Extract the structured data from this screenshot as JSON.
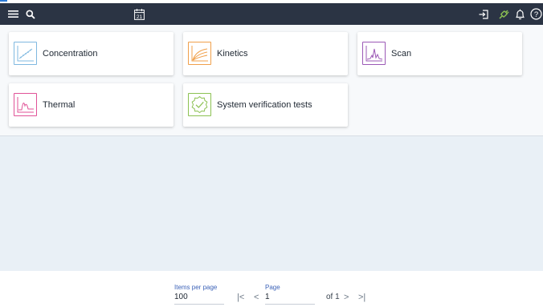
{
  "toolbar": {
    "menu_icon": "menu-icon",
    "search_icon": "search-icon",
    "calendar_icon": "calendar-icon",
    "calendar_day": "21",
    "logout_icon": "sign-in-icon",
    "connection_icon": "connection-plug-icon",
    "notifications_icon": "bell-icon",
    "help_icon": "help-icon",
    "help_glyph": "?"
  },
  "tiles": [
    {
      "label": "Concentration",
      "icon": "concentration-chart-icon",
      "color": "#7fb8e0"
    },
    {
      "label": "Kinetics",
      "icon": "kinetics-curve-icon",
      "color": "#f0a04b"
    },
    {
      "label": "Scan",
      "icon": "scan-spectrum-icon",
      "color": "#9b59b6"
    },
    {
      "label": "Thermal",
      "icon": "thermal-peak-icon",
      "color": "#e05297"
    },
    {
      "label": "System verification tests",
      "icon": "verification-check-icon",
      "color": "#8cc152"
    }
  ],
  "pagination": {
    "items_per_page_label": "Items per page",
    "items_per_page_value": "100",
    "page_label": "Page",
    "page_value": "1",
    "of_text": "of 1",
    "first_glyph": "|<",
    "prev_glyph": "<",
    "next_glyph": ">",
    "last_glyph": ">|"
  },
  "colors": {
    "topbar": "#2b3444",
    "connection": "#8cc152",
    "accent_label": "#3d63b8"
  }
}
